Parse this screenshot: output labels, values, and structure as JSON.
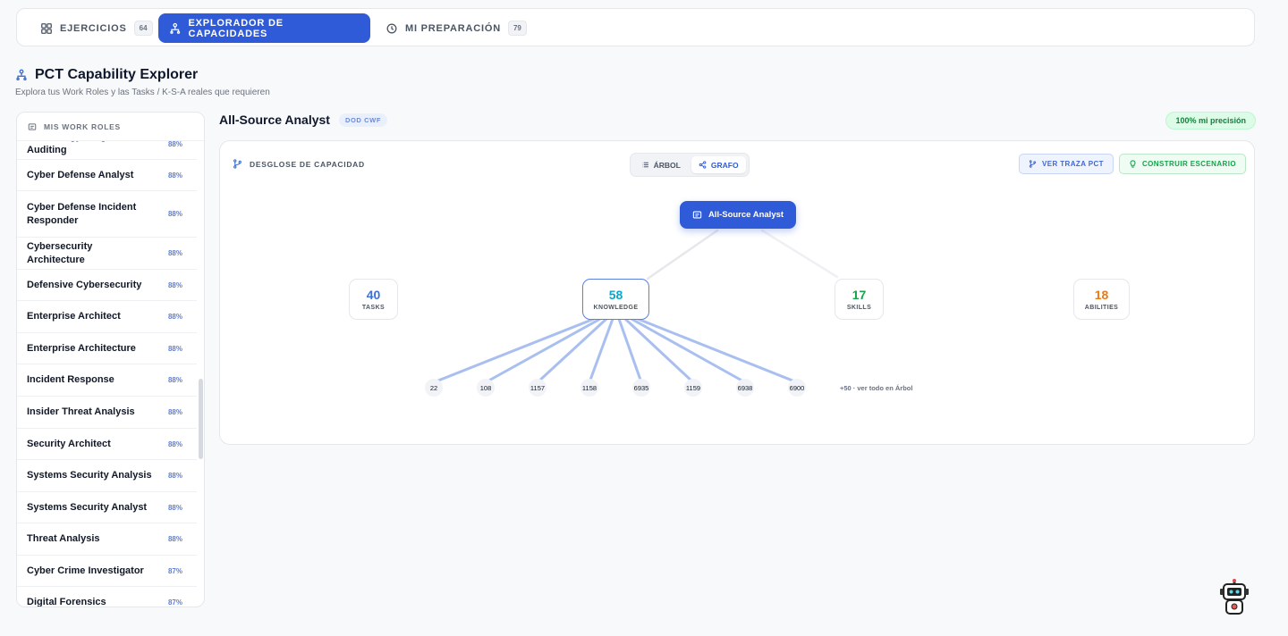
{
  "tabs": [
    {
      "label": "EJERCICIOS",
      "count": "64",
      "icon": "grid-icon",
      "active": false
    },
    {
      "label": "EXPLORADOR DE CAPACIDADES",
      "count": "",
      "icon": "hierarchy-icon",
      "active": true
    },
    {
      "label": "MI PREPARACIÓN",
      "count": "79",
      "icon": "history-icon",
      "active": false
    }
  ],
  "header": {
    "title": "PCT Capability Explorer",
    "subtitle": "Explora tus Work Roles y las Tasks / K-S-A reales que requieren"
  },
  "sidebar": {
    "heading": "MIS WORK ROLES",
    "items": [
      {
        "name": "Technology Program Auditing",
        "pct": "88%"
      },
      {
        "name": "Cyber Defense Analyst",
        "pct": "88%"
      },
      {
        "name": "Cyber Defense Incident Responder",
        "pct": "88%"
      },
      {
        "name": "Cybersecurity Architecture",
        "pct": "88%"
      },
      {
        "name": "Defensive Cybersecurity",
        "pct": "88%"
      },
      {
        "name": "Enterprise Architect",
        "pct": "88%"
      },
      {
        "name": "Enterprise Architecture",
        "pct": "88%"
      },
      {
        "name": "Incident Response",
        "pct": "88%"
      },
      {
        "name": "Insider Threat Analysis",
        "pct": "88%"
      },
      {
        "name": "Security Architect",
        "pct": "88%"
      },
      {
        "name": "Systems Security Analysis",
        "pct": "88%"
      },
      {
        "name": "Systems Security Analyst",
        "pct": "88%"
      },
      {
        "name": "Threat Analysis",
        "pct": "88%"
      },
      {
        "name": "Cyber Crime Investigator",
        "pct": "87%"
      },
      {
        "name": "Digital Forensics",
        "pct": "87%"
      }
    ]
  },
  "role": {
    "title": "All-Source Analyst",
    "badge": "DOD CWF",
    "precision": "100% mi precisión"
  },
  "panel": {
    "label": "DESGLOSE DE CAPACIDAD",
    "toggle": {
      "tree": "ÁRBOL",
      "graph": "GRAFO",
      "active": "graph"
    },
    "trace_button": "VER TRAZA PCT",
    "scenario_button": "CONSTRUIR ESCENARIO"
  },
  "graph": {
    "root": "All-Source Analyst",
    "categories": [
      {
        "key": "tasks",
        "count": "40",
        "label": "TASKS",
        "color": "#3b6fd9"
      },
      {
        "key": "knowledge",
        "count": "58",
        "label": "KNOWLEDGE",
        "color": "#0ea5c6"
      },
      {
        "key": "skills",
        "count": "17",
        "label": "SKILLS",
        "color": "#16a34a"
      },
      {
        "key": "abilities",
        "count": "18",
        "label": "ABILITIES",
        "color": "#ea7a17"
      }
    ],
    "leaves": [
      "22",
      "108",
      "1157",
      "1158",
      "6935",
      "1159",
      "6938",
      "6900"
    ],
    "more": "+50 · ver todo en Árbol"
  },
  "colors": {
    "accent": "#2f5bd8",
    "success": "#16a34a",
    "muted": "#6b7280"
  }
}
